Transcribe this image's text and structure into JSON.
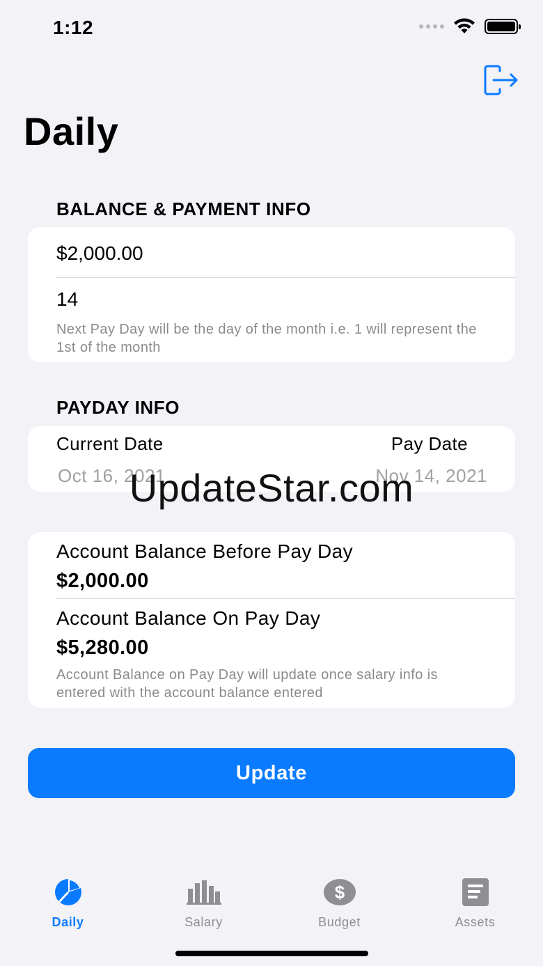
{
  "status_bar": {
    "time": "1:12"
  },
  "header": {
    "title": "Daily"
  },
  "balance_section": {
    "header": "BALANCE & PAYMENT INFO",
    "balance_value": "$2,000.00",
    "payday_value": "14",
    "helper_text": "Next Pay Day will be the day of the month i.e. 1 will represent the 1st of the month"
  },
  "payday_section": {
    "header": "PAYDAY INFO",
    "current_date_label": "Current Date",
    "current_date_value": "Oct 16, 2021",
    "pay_date_label": "Pay Date",
    "pay_date_value": "Nov 14, 2021"
  },
  "balances": {
    "before_label": "Account Balance Before Pay Day",
    "before_value": "$2,000.00",
    "on_label": "Account Balance On Pay Day",
    "on_value": "$5,280.00",
    "helper_text": "Account Balance on Pay Day will update once salary info is entered with the account balance entered"
  },
  "actions": {
    "update_label": "Update"
  },
  "tabs": [
    {
      "label": "Daily",
      "icon": "pie-chart-icon",
      "active": true
    },
    {
      "label": "Salary",
      "icon": "bar-chart-icon",
      "active": false
    },
    {
      "label": "Budget",
      "icon": "dollar-circle-icon",
      "active": false
    },
    {
      "label": "Assets",
      "icon": "document-icon",
      "active": false
    }
  ],
  "watermark": "UpdateStar.com",
  "colors": {
    "accent": "#0a7aff",
    "background": "#f2f2f7",
    "secondary_text": "#8a8a8e",
    "inactive_tab": "#8e8e93"
  }
}
